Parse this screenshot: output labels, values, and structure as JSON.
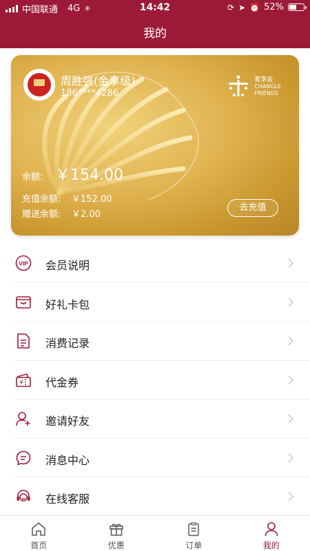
{
  "status_bar": {
    "carrier": "中国联通",
    "network": "4G",
    "time": "14:42",
    "battery": "52%",
    "battery_level": 0.52
  },
  "header": {
    "title": "我的"
  },
  "card": {
    "user_name": "周胜强(金享级)",
    "phone": "186****4286",
    "brand_cn": "麦享会",
    "brand_en_1": "CHANGLE",
    "brand_en_2": "FRIENDS",
    "balance_label": "余额:",
    "balance_value": "￥154.00",
    "recharge_label": "充值余额:",
    "recharge_value": "￥152.00",
    "gift_label": "赠送余额:",
    "gift_value": "￥2.00",
    "recharge_button": "去充值"
  },
  "menu": {
    "items": [
      {
        "label": "会员说明",
        "icon": "vip-icon"
      },
      {
        "label": "好礼卡包",
        "icon": "wallet-icon"
      },
      {
        "label": "消费记录",
        "icon": "document-icon"
      },
      {
        "label": "代金券",
        "icon": "voucher-icon"
      },
      {
        "label": "邀请好友",
        "icon": "add-user-icon"
      },
      {
        "label": "消息中心",
        "icon": "message-icon"
      },
      {
        "label": "在线客服",
        "icon": "customer-service-icon"
      }
    ]
  },
  "tabs": [
    {
      "label": "首页",
      "icon": "home-icon",
      "active": false
    },
    {
      "label": "优惠",
      "icon": "gift-icon",
      "active": false
    },
    {
      "label": "订单",
      "icon": "clipboard-icon",
      "active": false
    },
    {
      "label": "我的",
      "icon": "user-icon",
      "active": true
    }
  ],
  "colors": {
    "brand": "#9c1a37",
    "card_gold": "#dfb24f",
    "text": "#222222"
  }
}
